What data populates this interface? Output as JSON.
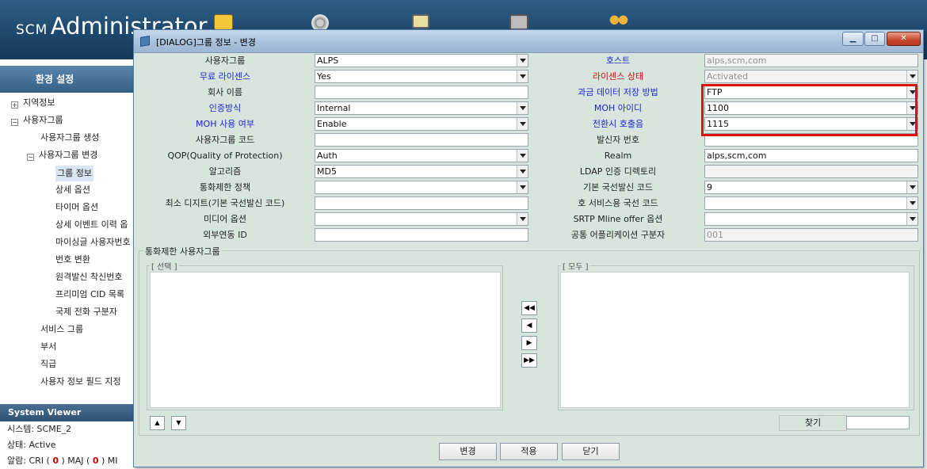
{
  "app": {
    "brand_prefix": "SCM",
    "brand_name": "Administrator"
  },
  "sidebar": {
    "section_title": "환경 설정",
    "items": [
      {
        "label": "지역정보",
        "level": 0,
        "expander": "+"
      },
      {
        "label": "사용자그룹",
        "level": 0,
        "expander": "−"
      },
      {
        "label": "사용자그룹 생성",
        "level": 1
      },
      {
        "label": "사용자그룹 변경",
        "level": 1,
        "expander": "−"
      },
      {
        "label": "그룹 정보",
        "level": 2,
        "selected": true
      },
      {
        "label": "상세 옵션",
        "level": 2
      },
      {
        "label": "타이머 옵션",
        "level": 2
      },
      {
        "label": "상세 이벤트 이력 옵",
        "level": 2
      },
      {
        "label": "마이싱글 사용자번호",
        "level": 2
      },
      {
        "label": "번호 변환",
        "level": 2
      },
      {
        "label": "원격발신 착신번호",
        "level": 2
      },
      {
        "label": "프리미엄 CID 목록",
        "level": 2
      },
      {
        "label": "국제 전화 구분자",
        "level": 2
      },
      {
        "label": "서비스 그룹",
        "level": 1
      },
      {
        "label": "부서",
        "level": 1
      },
      {
        "label": "직급",
        "level": 1
      },
      {
        "label": "사용자 정보 필드 지정",
        "level": 1
      }
    ]
  },
  "system_viewer": {
    "title": "System Viewer",
    "system_line": "시스템: SCME_2",
    "status_line": "상태: Active",
    "alarm_label": "알람:",
    "alarm_crit_label": "CRI (",
    "alarm_crit_value": "0",
    "alarm_maj_label": ") MAJ (",
    "alarm_maj_value": "0",
    "alarm_min_label": ") MI"
  },
  "dialog": {
    "title": "[DIALOG]그룹 정보 - 변경",
    "rows": [
      {
        "left_label": "사용자그룹",
        "left_color": "black",
        "left_value": "ALPS",
        "left_type": "combo",
        "right_label": "호스트",
        "right_color": "blue",
        "right_value": "alps,scm,com",
        "right_type": "text-disabled"
      },
      {
        "left_label": "무료 라이센스",
        "left_color": "blue",
        "left_value": "Yes",
        "left_type": "combo",
        "right_label": "라이센스 상태",
        "right_color": "red",
        "right_value": "Activated",
        "right_type": "combo-disabled"
      },
      {
        "left_label": "회사 이름",
        "left_color": "black",
        "left_value": "",
        "left_type": "text",
        "right_label": "과금 데이터 저장 방법",
        "right_color": "blue",
        "right_value": "FTP",
        "right_type": "combo"
      },
      {
        "left_label": "인증방식",
        "left_color": "blue",
        "left_value": "Internal",
        "left_type": "combo",
        "right_label": "MOH 아이디",
        "right_color": "blue",
        "right_value": "1100",
        "right_type": "combo"
      },
      {
        "left_label": "MOH 사용 여부",
        "left_color": "blue",
        "left_value": "Enable",
        "left_type": "combo",
        "right_label": "전환시 호출음",
        "right_color": "blue",
        "right_value": "1115",
        "right_type": "combo"
      },
      {
        "left_label": "사용자그룹 코드",
        "left_color": "black",
        "left_value": "",
        "left_type": "text",
        "right_label": "발신자 번호",
        "right_color": "black",
        "right_value": "",
        "right_type": "text"
      },
      {
        "left_label": "QOP(Quality of Protection)",
        "left_color": "black",
        "left_value": "Auth",
        "left_type": "combo",
        "right_label": "Realm",
        "right_color": "black",
        "right_value": "alps,scm,com",
        "right_type": "text"
      },
      {
        "left_label": "알고리즘",
        "left_color": "black",
        "left_value": "MD5",
        "left_type": "combo",
        "right_label": "LDAP 인증 디렉토리",
        "right_color": "black",
        "right_value": "",
        "right_type": "text-disabled"
      },
      {
        "left_label": "통화제한 정책",
        "left_color": "black",
        "left_value": "",
        "left_type": "combo",
        "right_label": "기본 국선발신 코드",
        "right_color": "black",
        "right_value": "9",
        "right_type": "combo"
      },
      {
        "left_label": "최소 디지트(기본 국선발신 코드)",
        "left_color": "black",
        "left_value": "",
        "left_type": "text",
        "right_label": "호 서비스용 국선 코드",
        "right_color": "black",
        "right_value": "",
        "right_type": "combo"
      },
      {
        "left_label": "미디어 옵션",
        "left_color": "black",
        "left_value": "",
        "left_type": "combo",
        "right_label": "SRTP Mline offer 옵션",
        "right_color": "black",
        "right_value": "",
        "right_type": "combo"
      },
      {
        "left_label": "외부연동 ID",
        "left_color": "black",
        "left_value": "",
        "left_type": "text",
        "right_label": "공통 어플리케이션 구분자",
        "right_color": "black",
        "right_value": "001",
        "right_type": "text-disabled"
      }
    ],
    "group_section": {
      "title": "통화제한 사용자그룹",
      "selected_title": "[ 선택 ]",
      "all_title": "[ 모두 ]",
      "move_buttons": [
        "◀◀",
        "◀",
        "▶",
        "▶▶"
      ],
      "up_label": "▲",
      "down_label": "▼",
      "find_label": "찾기",
      "find_value": ""
    },
    "buttons": {
      "change": "변경",
      "apply": "적용",
      "close": "닫기"
    }
  }
}
